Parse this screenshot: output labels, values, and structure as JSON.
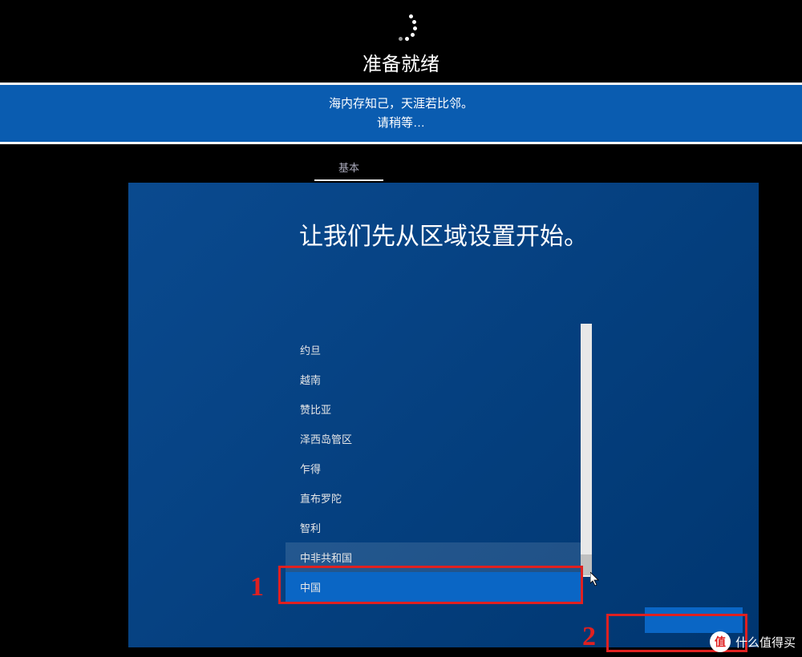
{
  "panel1": {
    "status": "准备就绪"
  },
  "panel2": {
    "line1": "海内存知己，天涯若比邻。",
    "line2": "请稍等…"
  },
  "tab": {
    "label": "基本"
  },
  "oobe": {
    "title": "让我们先从区域设置开始。"
  },
  "region_list": {
    "items": [
      "约旦",
      "越南",
      "赞比亚",
      "泽西岛管区",
      "乍得",
      "直布罗陀",
      "智利",
      "中非共和国",
      "中国"
    ],
    "hover_index": 7,
    "selected_index": 8
  },
  "next_button": {
    "label": ""
  },
  "annotations": {
    "label1": "1",
    "label2": "2"
  },
  "watermark": {
    "badge": "值",
    "text": "什么值得买"
  }
}
